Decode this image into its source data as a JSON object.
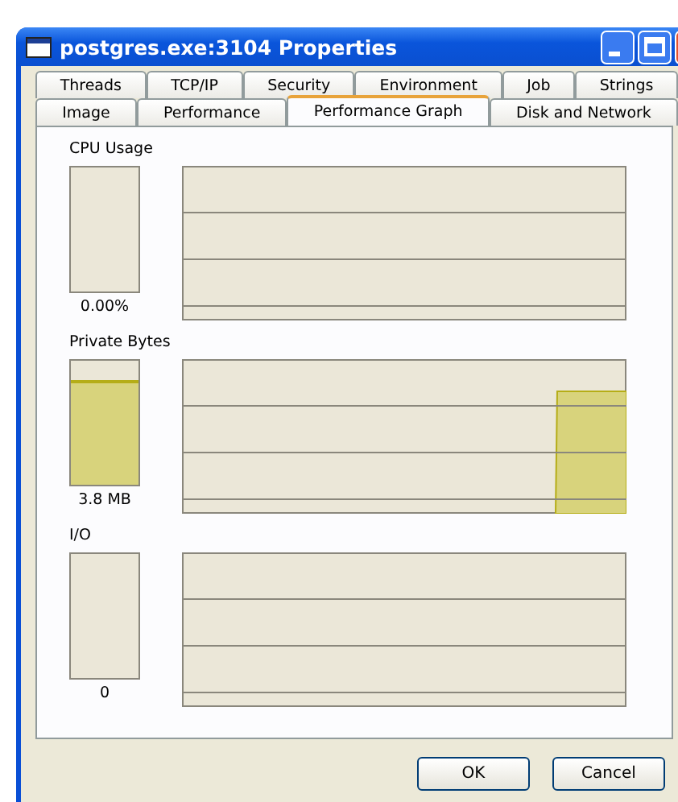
{
  "window": {
    "title": "postgres.exe:3104 Properties"
  },
  "tab_rows": [
    {
      "tabs": [
        {
          "label": "Threads",
          "selected": false
        },
        {
          "label": "TCP/IP",
          "selected": false
        },
        {
          "label": "Security",
          "selected": false
        },
        {
          "label": "Environment",
          "selected": false
        },
        {
          "label": "Job",
          "selected": false
        },
        {
          "label": "Strings",
          "selected": false
        }
      ]
    },
    {
      "tabs": [
        {
          "label": "Image",
          "selected": false
        },
        {
          "label": "Performance",
          "selected": false
        },
        {
          "label": "Performance Graph",
          "selected": true
        },
        {
          "label": "Disk and Network",
          "selected": false
        }
      ]
    }
  ],
  "sections": [
    {
      "label": "CPU Usage",
      "kind": "flat",
      "reading": "0.00%"
    },
    {
      "label": "Private Bytes",
      "kind": "rise",
      "level": 0.84,
      "reading": "3.8 MB"
    },
    {
      "label": "I/O",
      "kind": "flat",
      "reading": "0"
    }
  ],
  "buttons": [
    "OK",
    "Cancel"
  ]
}
